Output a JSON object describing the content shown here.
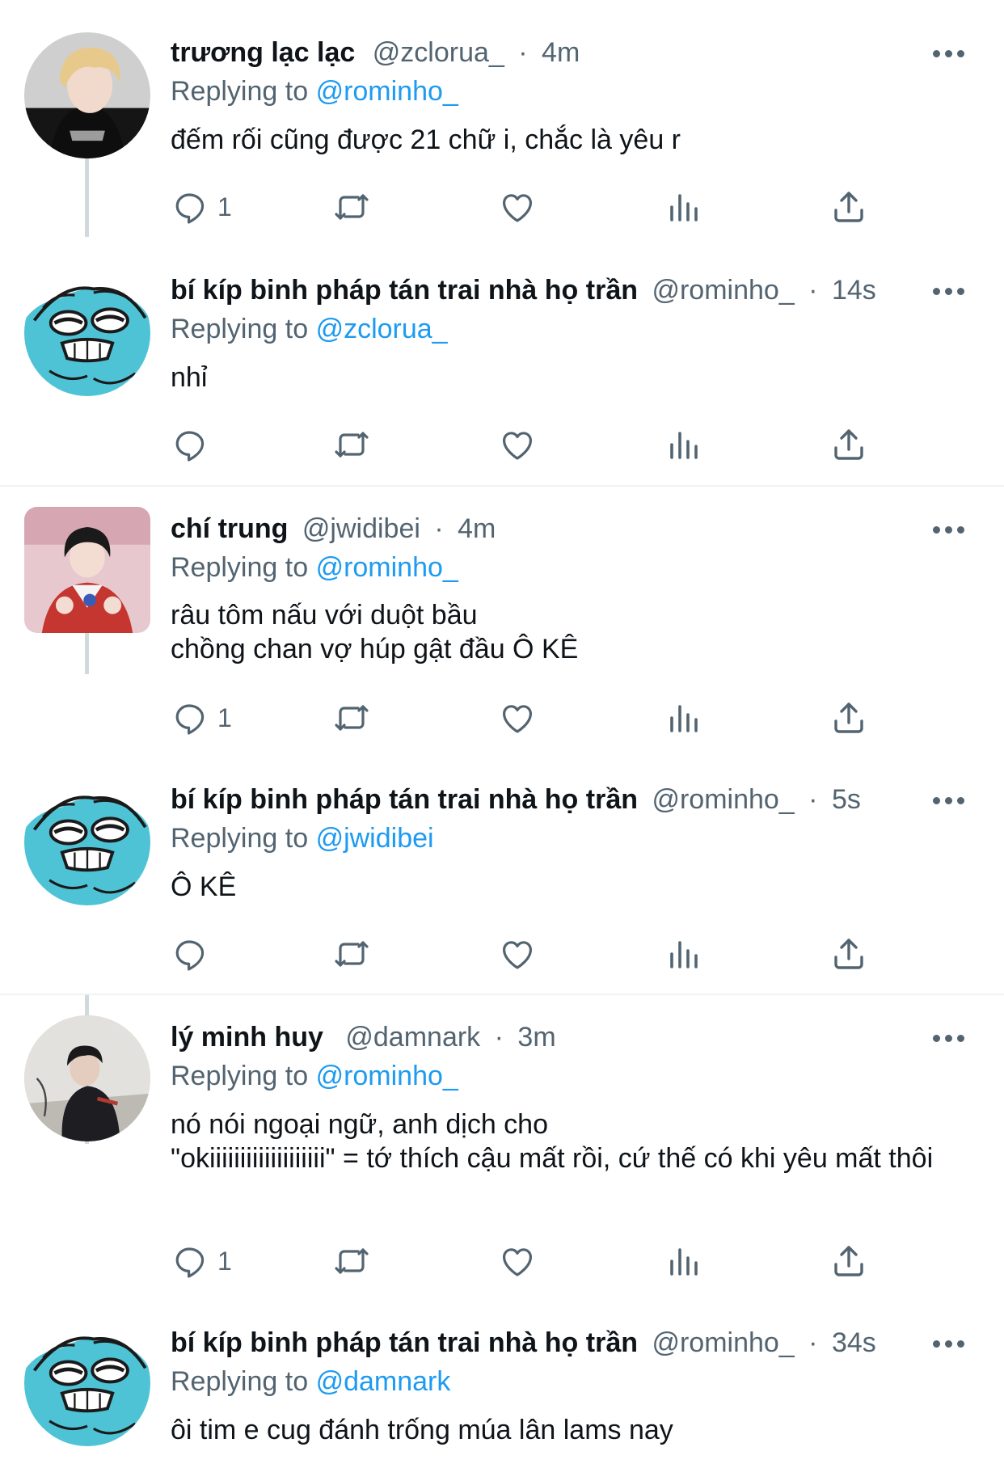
{
  "replying_label": "Replying to",
  "colors": {
    "accent": "#1d9bf0",
    "muted": "#536471",
    "text": "#0f1419"
  },
  "icons": [
    "reply-icon",
    "retweet-icon",
    "like-icon",
    "analytics-icon",
    "share-icon",
    "more-icon"
  ],
  "tweets": [
    {
      "name": "trương lạc lạc",
      "handle": "@zclorua_",
      "sep": "·",
      "time": "4m",
      "replying_to": "@rominho_",
      "text": "đếm rối cũng được 21 chữ i, chắc là yêu r",
      "reply_count": "1",
      "avatar": "photo-blond-boy"
    },
    {
      "name": "bí kíp binh pháp tán trai nhà họ trần",
      "handle": "@rominho_",
      "sep": "·",
      "time": "14s",
      "replying_to": "@zclorua_",
      "text": "nhỉ",
      "reply_count": "",
      "avatar": "cartoon-blue-cat"
    },
    {
      "name": "chí trung",
      "handle": "@jwidibei",
      "sep": "·",
      "time": "4m",
      "replying_to": "@rominho_",
      "text": "râu tôm nấu với duột bầu\nchồng chan vợ húp gật đầu Ô KÊ",
      "reply_count": "1",
      "avatar": "photo-boy-pink"
    },
    {
      "name": "bí kíp binh pháp tán trai nhà họ trần",
      "handle": "@rominho_",
      "sep": "·",
      "time": "5s",
      "replying_to": "@jwidibei",
      "text": "Ô KÊ",
      "reply_count": "",
      "avatar": "cartoon-blue-cat"
    },
    {
      "name": "lý minh huy",
      "handle": "@damnark",
      "sep": "·",
      "time": "3m",
      "replying_to": "@rominho_",
      "text": "nó nói ngoại ngữ, anh dịch cho\n\"okiiiiiiiiiiiiiiiiiii\" = tớ thích cậu mất rồi, cứ thế có khi yêu mất thôi",
      "reply_count": "1",
      "avatar": "photo-boy-crouching"
    },
    {
      "name": "bí kíp binh pháp tán trai nhà họ trần",
      "handle": "@rominho_",
      "sep": "·",
      "time": "34s",
      "replying_to": "@damnark",
      "text": "ôi tim e cug đánh trống múa lân lams nay",
      "reply_count": "",
      "avatar": "cartoon-blue-cat"
    }
  ]
}
